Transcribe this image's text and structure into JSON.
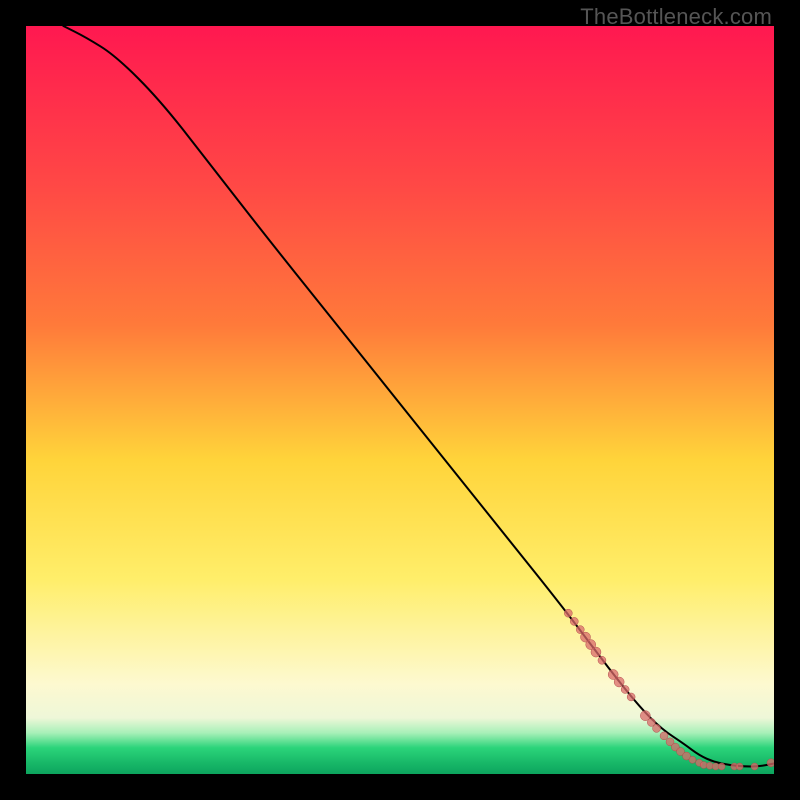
{
  "watermark": "TheBottleneck.com",
  "colors": {
    "gradient_top": "#ff1850",
    "gradient_mid_upper": "#ff7a3a",
    "gradient_mid": "#ffd43a",
    "gradient_mid_lower": "#ffee6a",
    "gradient_low": "#fdf9d0",
    "gradient_green_light": "#a8f0b8",
    "gradient_green": "#2bd47a",
    "curve": "#000000",
    "dot_fill": "#d96a6a",
    "dot_stroke": "#b24d4d"
  },
  "chart_data": {
    "type": "line",
    "title": "",
    "xlabel": "",
    "ylabel": "",
    "xlim": [
      0,
      100
    ],
    "ylim": [
      0,
      100
    ],
    "grid": false,
    "legend": false,
    "series": [
      {
        "name": "curve",
        "x": [
          5,
          8,
          12,
          18,
          25,
          32,
          40,
          48,
          56,
          64,
          72,
          78,
          82,
          85,
          88,
          90,
          92,
          94,
          96,
          98,
          100
        ],
        "y": [
          100,
          98.5,
          96,
          90,
          81,
          72,
          62,
          52,
          42,
          32,
          22,
          14,
          9,
          6,
          4,
          2.5,
          1.6,
          1.2,
          1.0,
          1.0,
          1.4
        ]
      }
    ],
    "scatter": [
      {
        "name": "dots",
        "points": [
          {
            "x": 72.5,
            "y": 21.5,
            "r": 4
          },
          {
            "x": 73.3,
            "y": 20.4,
            "r": 4
          },
          {
            "x": 74.1,
            "y": 19.3,
            "r": 4
          },
          {
            "x": 74.8,
            "y": 18.3,
            "r": 5
          },
          {
            "x": 75.5,
            "y": 17.3,
            "r": 5
          },
          {
            "x": 76.2,
            "y": 16.3,
            "r": 5
          },
          {
            "x": 77.0,
            "y": 15.2,
            "r": 4
          },
          {
            "x": 78.5,
            "y": 13.3,
            "r": 5
          },
          {
            "x": 79.3,
            "y": 12.3,
            "r": 5
          },
          {
            "x": 80.1,
            "y": 11.3,
            "r": 4
          },
          {
            "x": 80.9,
            "y": 10.3,
            "r": 4
          },
          {
            "x": 82.8,
            "y": 7.8,
            "r": 5
          },
          {
            "x": 83.6,
            "y": 6.9,
            "r": 4
          },
          {
            "x": 84.3,
            "y": 6.1,
            "r": 4
          },
          {
            "x": 85.3,
            "y": 5.1,
            "r": 4
          },
          {
            "x": 86.1,
            "y": 4.3,
            "r": 4
          },
          {
            "x": 86.8,
            "y": 3.6,
            "r": 4
          },
          {
            "x": 87.5,
            "y": 3.0,
            "r": 4
          },
          {
            "x": 88.3,
            "y": 2.4,
            "r": 4
          },
          {
            "x": 89.1,
            "y": 1.9,
            "r": 3.5
          },
          {
            "x": 90.0,
            "y": 1.5,
            "r": 3.5
          },
          {
            "x": 90.6,
            "y": 1.2,
            "r": 3.5
          },
          {
            "x": 91.4,
            "y": 1.1,
            "r": 3.5
          },
          {
            "x": 92.2,
            "y": 1.0,
            "r": 3.5
          },
          {
            "x": 93.0,
            "y": 1.0,
            "r": 3.5
          },
          {
            "x": 94.7,
            "y": 1.0,
            "r": 3.5
          },
          {
            "x": 95.4,
            "y": 1.0,
            "r": 3.5
          },
          {
            "x": 97.4,
            "y": 1.0,
            "r": 3.5
          },
          {
            "x": 99.6,
            "y": 1.5,
            "r": 4
          }
        ]
      }
    ]
  }
}
